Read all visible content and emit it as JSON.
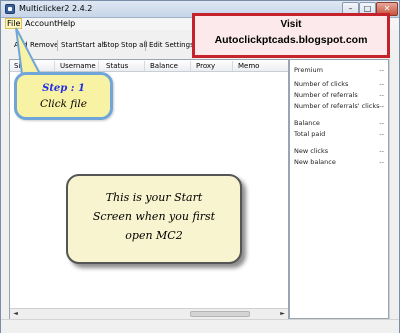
{
  "window": {
    "title": "Multiclicker2 2.4.2"
  },
  "title_buttons": {
    "minimize": "–",
    "maximize": "□",
    "close": "✕"
  },
  "menu": {
    "file": "File",
    "account": "Account",
    "help": "Help"
  },
  "toolbar": {
    "add": "Add",
    "remove": "Remove",
    "start": "Start",
    "start_all": "Start all",
    "stop": "Stop",
    "stop_all": "Stop all",
    "edit": "Edit",
    "settings": "Settings"
  },
  "grid": {
    "columns": [
      "Site",
      "Username",
      "Status",
      "Balance",
      "Proxy",
      "Memo"
    ],
    "scroll_left": "◄",
    "scroll_right": "►"
  },
  "stats": [
    {
      "label": "Premium",
      "value": "--"
    },
    {
      "label": "Number of clicks",
      "value": "--"
    },
    {
      "label": "Number of referrals",
      "value": "--"
    },
    {
      "label": "Number of referrals' clicks",
      "value": "--"
    },
    {
      "label": "Balance",
      "value": "--"
    },
    {
      "label": "Total paid",
      "value": "--"
    },
    {
      "label": "New clicks",
      "value": "--"
    },
    {
      "label": "New balance",
      "value": "--"
    }
  ],
  "callouts": {
    "visit_title": "Visit",
    "visit_site": "Autoclickptcads.blogspot.com",
    "step_title": "Step : 1",
    "step_text": "Click file",
    "start_line1": "This is  your Start",
    "start_line2": "Screen when you first",
    "start_line3": "open MC2"
  },
  "colors": {
    "visit_border": "#c5222c",
    "step_fill": "#f8f2a5",
    "step_border": "#6fa5d8",
    "step_title": "#1f2de6",
    "start_fill": "#f8f4cf"
  }
}
